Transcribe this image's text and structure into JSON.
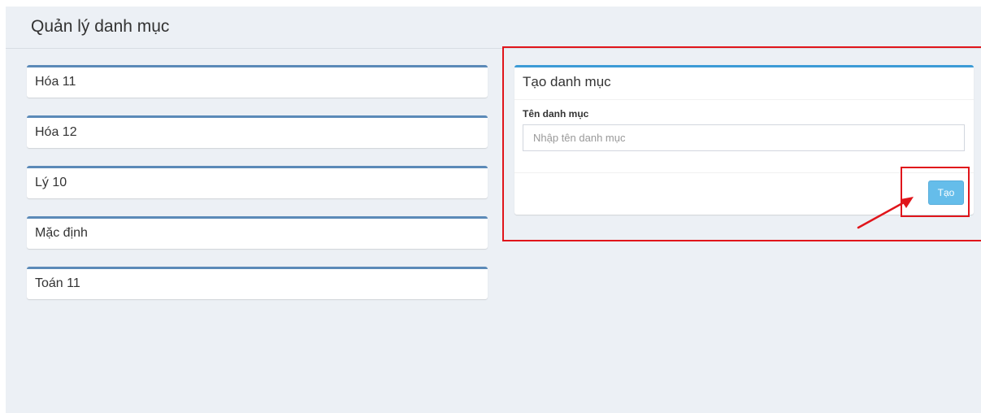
{
  "header": {
    "title": "Quản lý danh mục"
  },
  "categories": [
    {
      "label": "Hóa 11"
    },
    {
      "label": "Hóa 12"
    },
    {
      "label": "Lý 10"
    },
    {
      "label": "Mặc định"
    },
    {
      "label": "Toán 11"
    }
  ],
  "create_form": {
    "title": "Tạo danh mục",
    "field_label": "Tên danh mục",
    "input_value": "",
    "input_placeholder": "Nhập tên danh mục",
    "submit_label": "Tạo"
  },
  "colors": {
    "page_background": "#ecf0f5",
    "category_border": "#5b8ab8",
    "create_box_border": "#3c9bd6",
    "button_background": "#65bdea",
    "annotation_red": "#e0151b"
  },
  "icons": {
    "annotation": "red-arrow-icon"
  }
}
